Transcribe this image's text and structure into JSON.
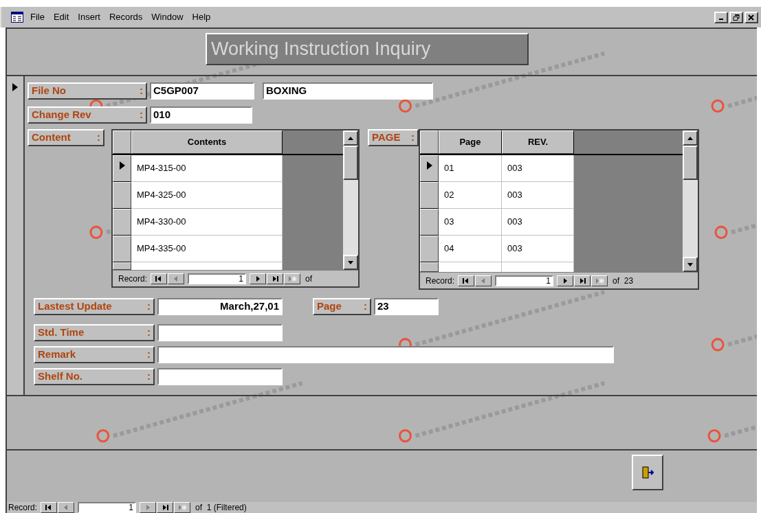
{
  "menu": [
    {
      "label": "File"
    },
    {
      "label": "Edit"
    },
    {
      "label": "Insert"
    },
    {
      "label": "Records"
    },
    {
      "label": "Window"
    },
    {
      "label": "Help"
    }
  ],
  "title": "Working Instruction Inquiry",
  "file_no": {
    "label": "File No",
    "colon": ":",
    "values": [
      "C5GP007",
      "BOXING"
    ]
  },
  "change_rev": {
    "label": "Change Rev",
    "colon": ":",
    "value": "010"
  },
  "contents": {
    "label": "Content",
    "colon": ":",
    "columns": [
      "Contents"
    ],
    "rows": [
      {
        "cells": [
          "MP4-315-00"
        ],
        "selected": true
      },
      {
        "cells": [
          "MP4-325-00"
        ],
        "selected": false
      },
      {
        "cells": [
          "MP4-330-00"
        ],
        "selected": false
      },
      {
        "cells": [
          "MP4-335-00"
        ],
        "selected": false
      }
    ],
    "nav": {
      "label": "Record:",
      "current": "1",
      "total": "of",
      "buttons": [
        {
          "kind": "first",
          "disabled": false
        },
        {
          "kind": "prev",
          "disabled": true
        },
        {
          "kind": "next",
          "disabled": false
        },
        {
          "kind": "last",
          "disabled": false
        },
        {
          "kind": "new",
          "disabled": true
        }
      ]
    }
  },
  "pages": {
    "label": "PAGE",
    "colon": ":",
    "columns": [
      "Page",
      "REV."
    ],
    "rows": [
      {
        "cells": [
          "01",
          "003"
        ],
        "selected": true
      },
      {
        "cells": [
          "02",
          "003"
        ],
        "selected": false
      },
      {
        "cells": [
          "03",
          "003"
        ],
        "selected": false
      },
      {
        "cells": [
          "04",
          "003"
        ],
        "selected": false
      }
    ],
    "nav": {
      "label": "Record:",
      "current": "1",
      "total": "of  23",
      "buttons": [
        {
          "kind": "first",
          "disabled": false
        },
        {
          "kind": "prev",
          "disabled": true
        },
        {
          "kind": "next",
          "disabled": false
        },
        {
          "kind": "last",
          "disabled": false
        },
        {
          "kind": "new",
          "disabled": true
        }
      ]
    }
  },
  "latest_update": {
    "label": "Lastest Update",
    "colon": ":",
    "value": "March,27,01"
  },
  "page_count": {
    "label": "Page",
    "colon": ":",
    "value": "23"
  },
  "std_time": {
    "label": "Std. Time",
    "colon": ":"
  },
  "remark": {
    "label": "Remark",
    "colon": ":"
  },
  "shelf_no": {
    "label": "Shelf No.",
    "colon": ":"
  },
  "record_nav": {
    "label": "Record:",
    "current": "1",
    "total": "of  1 (Filtered)",
    "buttons": [
      {
        "kind": "first",
        "disabled": false
      },
      {
        "kind": "prev",
        "disabled": true
      },
      {
        "kind": "next",
        "disabled": true
      },
      {
        "kind": "last",
        "disabled": false
      },
      {
        "kind": "new",
        "disabled": true
      }
    ]
  }
}
